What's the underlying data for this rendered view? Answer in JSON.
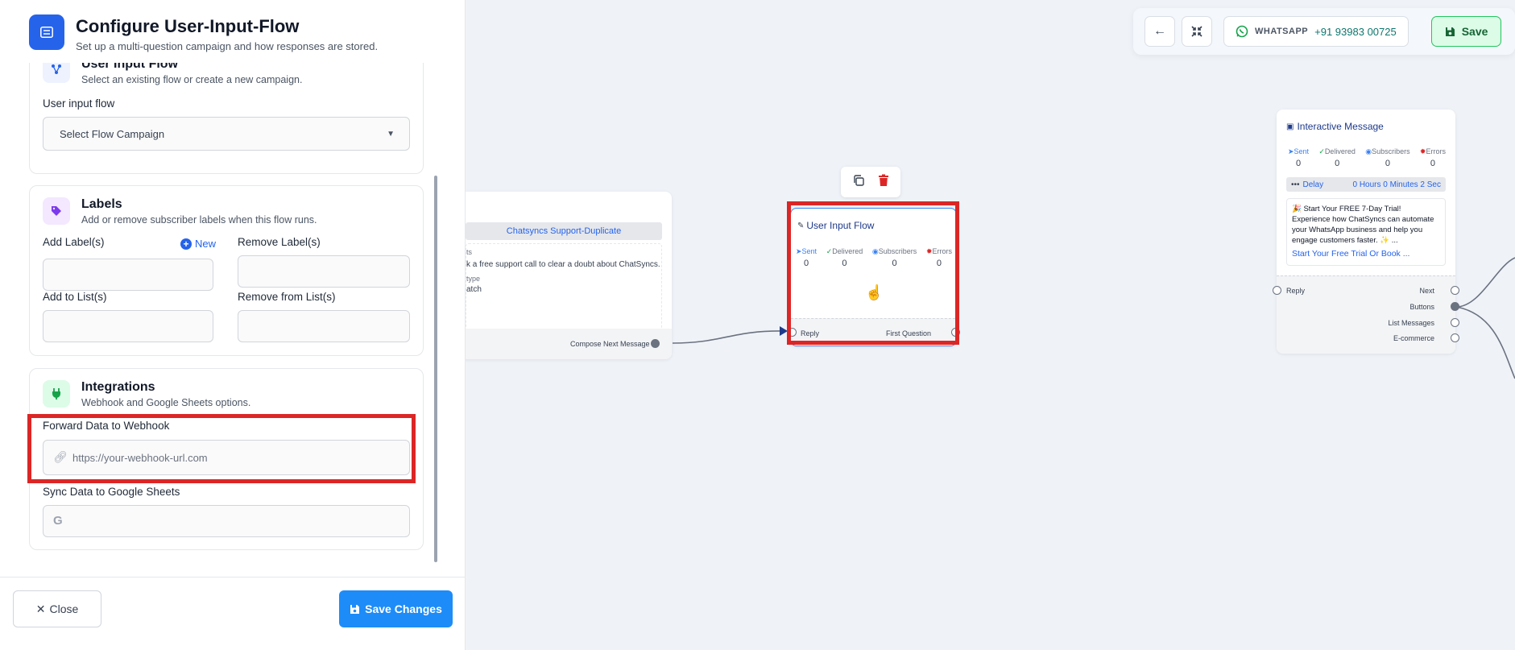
{
  "panel": {
    "title": "Configure User-Input-Flow",
    "subtitle": "Set up a multi-question campaign and how responses are stored.",
    "flow_section": {
      "title": "User Input Flow",
      "subtitle": "Select an existing flow or create a new campaign.",
      "field_label": "User input flow",
      "select_value": "Select Flow Campaign"
    },
    "labels_section": {
      "title": "Labels",
      "subtitle": "Add or remove subscriber labels when this flow runs.",
      "add_label": "Add Label(s)",
      "new_label": "New",
      "remove_label": "Remove Label(s)",
      "add_list": "Add to List(s)",
      "remove_list": "Remove from List(s)"
    },
    "integrations_section": {
      "title": "Integrations",
      "subtitle": "Webhook and Google Sheets options.",
      "webhook_label": "Forward Data to Webhook",
      "webhook_placeholder": "https://your-webhook-url.com",
      "sheets_label": "Sync Data to Google Sheets",
      "sheets_icon_letter": "G"
    },
    "footer": {
      "close": "Close",
      "save": "Save Changes"
    }
  },
  "toolbar": {
    "wa_label": "WHATSAPP",
    "wa_number": "+91 93983 00725",
    "save": "Save"
  },
  "stats_labels": {
    "sent": "Sent",
    "delivered": "Delivered",
    "subscribers": "Subscribers",
    "errors": "Errors"
  },
  "nodes": {
    "left": {
      "tag": "Chatsyncs Support-Duplicate",
      "line1": "ts",
      "line2": "k a free support call to clear a doubt about ChatSyncs.",
      "line3": "type",
      "line4": "atch",
      "port_out": "Compose Next Message"
    },
    "user_input": {
      "title": "User Input Flow",
      "sent": "0",
      "delivered": "0",
      "subscribers": "0",
      "errors": "0",
      "port_in": "Reply",
      "port_out": "First Question"
    },
    "interactive": {
      "title": "Interactive Message",
      "sent": "0",
      "delivered": "0",
      "subscribers": "0",
      "errors": "0",
      "delay_label": "Delay",
      "delay_value": "0 Hours 0 Minutes 2 Sec",
      "message": "🎉 Start Your FREE 7-Day Trial! Experience how ChatSyncs can automate your WhatsApp business and help you engage customers faster. ✨ ...",
      "link": "Start Your Free Trial Or Book ...",
      "port_in": "Reply",
      "ports_out": [
        "Next",
        "Buttons",
        "List Messages",
        "E-commerce"
      ]
    }
  },
  "colors": {
    "primary": "#2563eb",
    "save_button": "#1d8cf8",
    "highlight": "#dc2626",
    "success": "#22c55e"
  }
}
